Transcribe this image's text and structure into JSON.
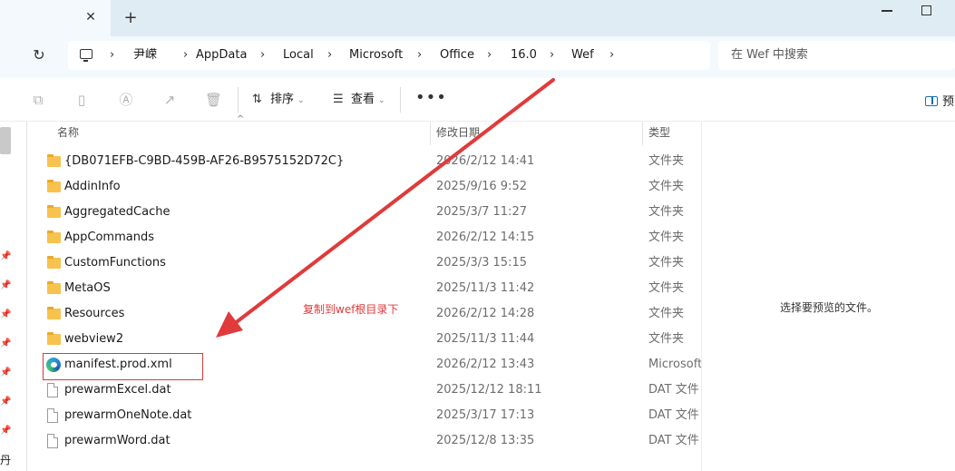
{
  "tabbar": {
    "close_glyph": "✕",
    "add_glyph": "+"
  },
  "address": {
    "refresh_glyph": "↻",
    "separator": "›",
    "crumbs": [
      "尹嵘",
      "AppData",
      "Local",
      "Microsoft",
      "Office",
      "16.0",
      "Wef"
    ],
    "search_placeholder": "在 Wef 中搜索"
  },
  "toolbar": {
    "sort_label": "排序",
    "view_label": "查看",
    "more_glyph": "•••",
    "preview_label": "预"
  },
  "columns": {
    "name": "名称",
    "date": "修改日期",
    "type": "类型"
  },
  "files": [
    {
      "name": "{DB071EFB-C9BD-459B-AF26-B9575152D72C}",
      "date": "2026/2/12 14:41",
      "type": "文件夹",
      "icon": "folder-icon"
    },
    {
      "name": "AddinInfo",
      "date": "2025/9/16 9:52",
      "type": "文件夹",
      "icon": "folder-icon"
    },
    {
      "name": "AggregatedCache",
      "date": "2025/3/7 11:27",
      "type": "文件夹",
      "icon": "folder-icon"
    },
    {
      "name": "AppCommands",
      "date": "2026/2/12 14:15",
      "type": "文件夹",
      "icon": "folder-icon"
    },
    {
      "name": "CustomFunctions",
      "date": "2025/3/3 15:15",
      "type": "文件夹",
      "icon": "folder-icon"
    },
    {
      "name": "MetaOS",
      "date": "2025/11/3 11:42",
      "type": "文件夹",
      "icon": "folder-icon"
    },
    {
      "name": "Resources",
      "date": "2026/2/12 14:28",
      "type": "文件夹",
      "icon": "folder-icon"
    },
    {
      "name": "webview2",
      "date": "2025/11/3 11:44",
      "type": "文件夹",
      "icon": "folder-icon"
    },
    {
      "name": "manifest.prod.xml",
      "date": "2026/2/12 13:43",
      "type": "Microsoft",
      "icon": "edge-icon"
    },
    {
      "name": "prewarmExcel.dat",
      "date": "2025/12/12 18:11",
      "type": "DAT 文件",
      "icon": "file-icon"
    },
    {
      "name": "prewarmOneNote.dat",
      "date": "2025/3/17 17:13",
      "type": "DAT 文件",
      "icon": "file-icon"
    },
    {
      "name": "prewarmWord.dat",
      "date": "2025/12/8 13:35",
      "type": "DAT 文件",
      "icon": "file-icon"
    }
  ],
  "preview": {
    "empty_text": "选择要预览的文件。"
  },
  "nav": {
    "bottom_char": "丹"
  },
  "annotation": {
    "text": "复制到wef根目录下",
    "color": "#e03a3a"
  }
}
